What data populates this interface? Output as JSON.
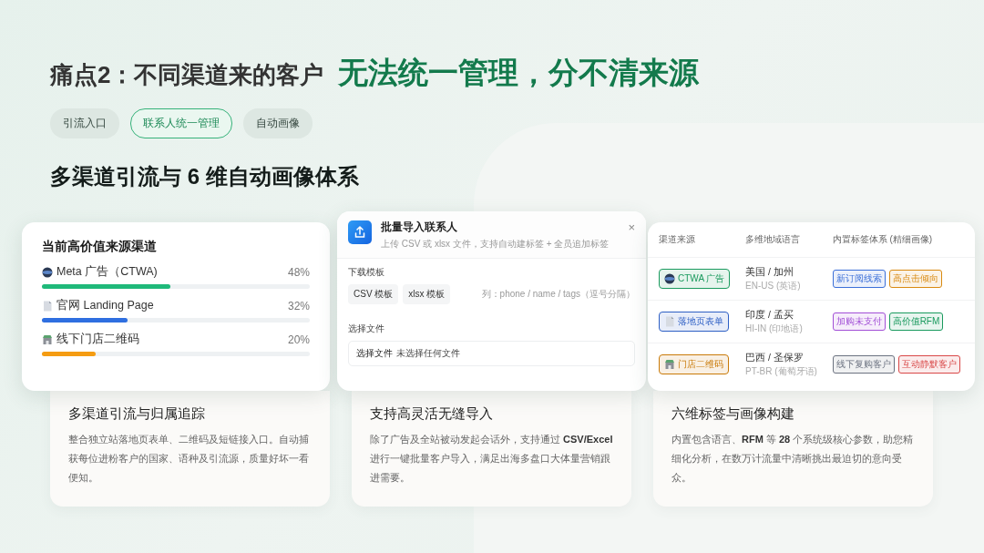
{
  "heading": {
    "prefix": "痛点2：不同渠道来的客户",
    "highlight": "无法统一管理，分不清来源"
  },
  "pills": [
    {
      "label": "引流入口",
      "selected": false
    },
    {
      "label": "联系人统一管理",
      "selected": true
    },
    {
      "label": "自动画像",
      "selected": false
    }
  ],
  "subtitle": "多渠道引流与 6 维自动画像体系",
  "channels_card": {
    "title": "当前高价值来源渠道",
    "items": [
      {
        "kind": "globe",
        "label": "Meta 广告（CTWA)",
        "percent": "48%",
        "level": 0.48,
        "color": "#1fb97a"
      },
      {
        "kind": "page",
        "label": "官网 Landing Page",
        "percent": "32%",
        "level": 0.32,
        "color": "#2f6fe0"
      },
      {
        "kind": "store",
        "label": "线下门店二维码",
        "percent": "20%",
        "level": 0.2,
        "color": "#f59c12"
      }
    ]
  },
  "import_dialog": {
    "title": "批量导入联系人",
    "description": "上传 CSV 或 xlsx 文件，支持自动建标签 + 全员追加标签",
    "close": "×",
    "template_label": "下载模板",
    "templates": [
      "CSV 模板",
      "xlsx 模板"
    ],
    "template_hint": "列：phone / name / tags（逗号分隔）",
    "file_label": "选择文件",
    "file_button": "选择文件",
    "file_status": "未选择任何文件"
  },
  "profile_table": {
    "columns": [
      "渠道来源",
      "多维地域语言",
      "内置标签体系 (精细画像)"
    ],
    "rows": [
      {
        "source": {
          "kind": "globe",
          "label": "CTWA 广告",
          "color": "#1a9a5e"
        },
        "region": "美国 / 加州",
        "locale": "EN-US (英语)",
        "tags": [
          {
            "label": "新订阅线索",
            "color": "#3b6fd8"
          },
          {
            "label": "高点击倾向",
            "color": "#d98a10"
          }
        ]
      },
      {
        "source": {
          "kind": "page",
          "label": "落地页表单",
          "color": "#2d5fc4"
        },
        "region": "印度 / 孟买",
        "locale": "HI-IN (印地语)",
        "tags": [
          {
            "label": "加购未支付",
            "color": "#a24fd6"
          },
          {
            "label": "高价值RFM",
            "color": "#1a9a5e"
          }
        ]
      },
      {
        "source": {
          "kind": "store",
          "label": "门店二维码",
          "color": "#c97a08"
        },
        "region": "巴西 / 圣保罗",
        "locale": "PT-BR (葡萄牙语)",
        "tags": [
          {
            "label": "线下复购客户",
            "color": "#6b7280"
          },
          {
            "label": "互动静默客户",
            "color": "#d94848"
          }
        ]
      }
    ]
  },
  "features": [
    {
      "title": "多渠道引流与归属追踪",
      "text": "整合独立站落地页表单、二维码及短链接入口。自动捕获每位进粉客户的国家、语种及引流源，质量好坏一看便知。"
    },
    {
      "title": "支持高灵活无缝导入",
      "text": "除了广告及全站被动发起会话外，支持通过 **CSV/Excel** 进行一键批量客户导入，满足出海多盘口大体量营销跟进需要。"
    },
    {
      "title": "六维标签与画像构建",
      "text": "内置包含语言、**RFM** 等 **28** 个系统级核心参数，助您精细化分析，在数万计流量中清晰挑出最迫切的意向受众。"
    }
  ]
}
